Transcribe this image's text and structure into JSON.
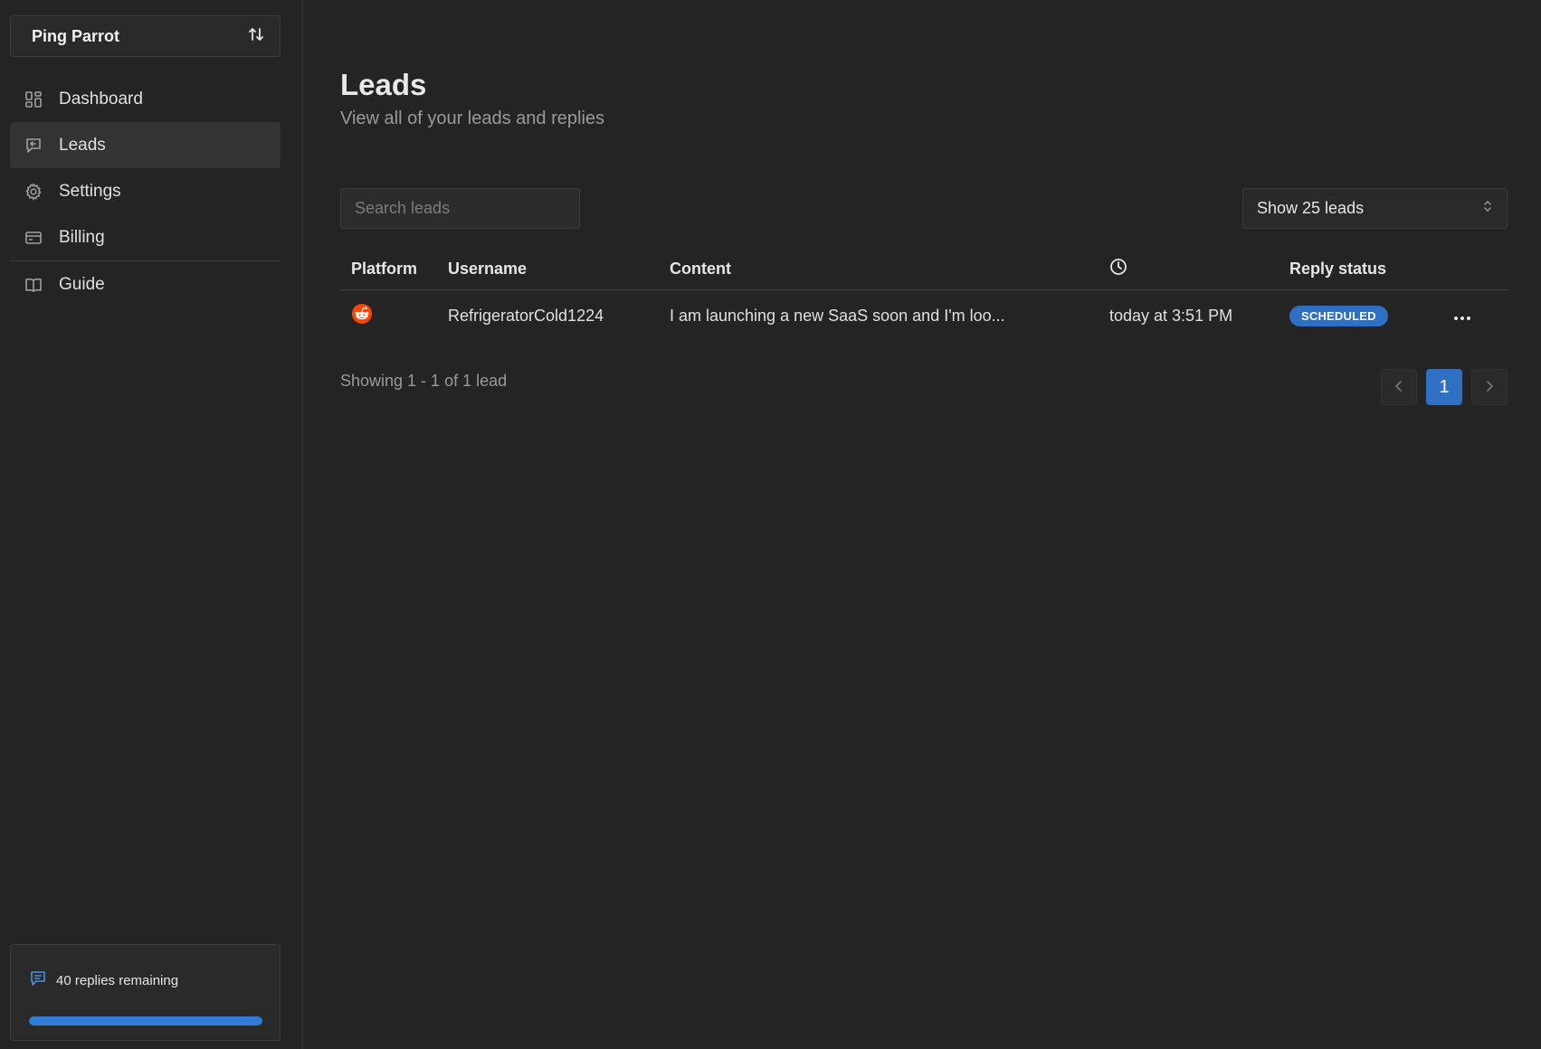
{
  "workspace": {
    "name": "Ping Parrot",
    "icon": "swap-vertical-icon"
  },
  "nav": {
    "items": [
      {
        "label": "Dashboard",
        "icon": "dashboard-icon"
      },
      {
        "label": "Leads",
        "icon": "message-icon",
        "active": true
      },
      {
        "label": "Settings",
        "icon": "gear-icon"
      },
      {
        "label": "Billing",
        "icon": "credit-card-icon"
      },
      {
        "label": "Guide",
        "icon": "book-icon"
      }
    ]
  },
  "quota": {
    "text": "40 replies remaining",
    "progress": 1.0,
    "icon": "chat-icon"
  },
  "page": {
    "title": "Leads",
    "subtitle": "View all of your leads and replies"
  },
  "search": {
    "placeholder": "Search leads"
  },
  "page_size": {
    "label": "Show 25 leads"
  },
  "table": {
    "headers": {
      "platform": "Platform",
      "username": "Username",
      "content": "Content",
      "time_icon": "clock-icon",
      "status": "Reply status"
    },
    "rows": [
      {
        "platform_icon": "reddit-icon",
        "username": "RefrigeratorCold1224",
        "content": "I am launching a new SaaS soon and I'm loo...",
        "time": "today at 3:51 PM",
        "status": "SCHEDULED"
      }
    ]
  },
  "footer": {
    "showing": "Showing 1 - 1 of 1 lead"
  },
  "pagination": {
    "current": "1",
    "prev_icon": "chevron-left-icon",
    "next_icon": "chevron-right-icon"
  },
  "colors": {
    "accent": "#2f6fc4",
    "reddit": "#ff4500",
    "background": "#242424"
  }
}
